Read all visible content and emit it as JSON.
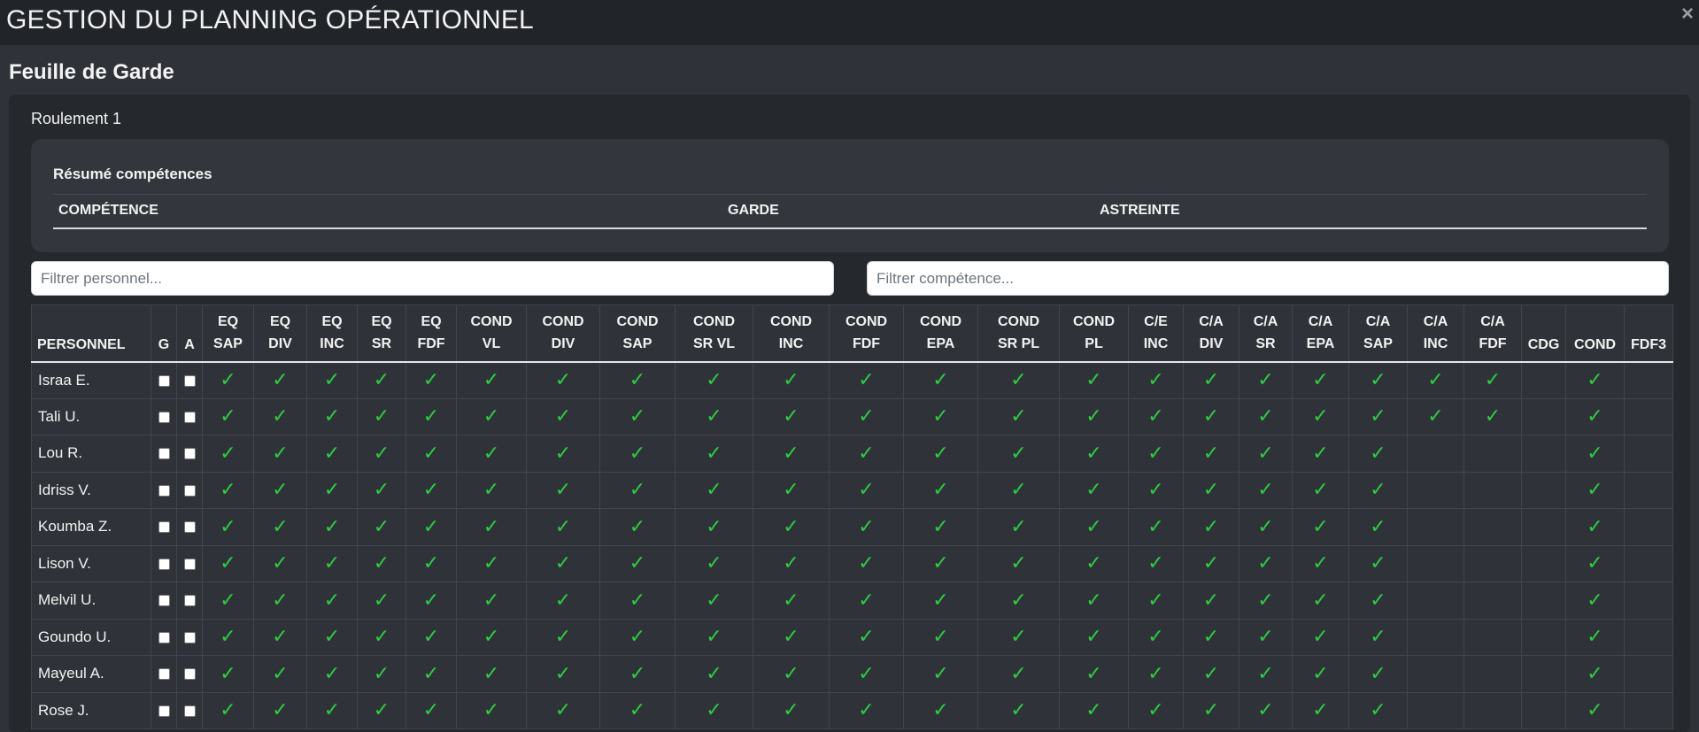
{
  "app": {
    "title": "GESTION DU PLANNING OPÉRATIONNEL",
    "close_label": "×"
  },
  "page": {
    "section_title": "Feuille de Garde",
    "roulement": "Roulement 1"
  },
  "summary": {
    "title": "Résumé compétences",
    "headers": [
      "COMPÉTENCE",
      "GARDE",
      "ASTREINTE"
    ]
  },
  "filters": {
    "personnel_placeholder": "Filtrer personnel...",
    "competence_placeholder": "Filtrer compétence..."
  },
  "colors": {
    "check": "#2ecc40",
    "background": "#2f3339",
    "header": "#212429"
  },
  "table": {
    "columns": [
      "PERSONNEL",
      "G",
      "A",
      "EQ SAP",
      "EQ DIV",
      "EQ INC",
      "EQ SR",
      "EQ FDF",
      "COND VL",
      "COND DIV",
      "COND SAP",
      "COND SR VL",
      "COND INC",
      "COND FDF",
      "COND EPA",
      "COND SR PL",
      "COND PL",
      "C/E INC",
      "C/A DIV",
      "C/A SR",
      "C/A EPA",
      "C/A SAP",
      "C/A INC",
      "C/A FDF",
      "CDG",
      "COND",
      "FDF3"
    ],
    "check_symbol": "✓",
    "rows": [
      {
        "name": "Israa E.",
        "checks": [
          1,
          1,
          1,
          1,
          1,
          1,
          1,
          1,
          1,
          1,
          1,
          1,
          1,
          1,
          1,
          1,
          1,
          1,
          1,
          1,
          1,
          0,
          1,
          0
        ]
      },
      {
        "name": "Tali U.",
        "checks": [
          1,
          1,
          1,
          1,
          1,
          1,
          1,
          1,
          1,
          1,
          1,
          1,
          1,
          1,
          1,
          1,
          1,
          1,
          1,
          1,
          1,
          0,
          1,
          0
        ]
      },
      {
        "name": "Lou R.",
        "checks": [
          1,
          1,
          1,
          1,
          1,
          1,
          1,
          1,
          1,
          1,
          1,
          1,
          1,
          1,
          1,
          1,
          1,
          1,
          1,
          0,
          0,
          0,
          1,
          0
        ]
      },
      {
        "name": "Idriss V.",
        "checks": [
          1,
          1,
          1,
          1,
          1,
          1,
          1,
          1,
          1,
          1,
          1,
          1,
          1,
          1,
          1,
          1,
          1,
          1,
          1,
          0,
          0,
          0,
          1,
          0
        ]
      },
      {
        "name": "Koumba Z.",
        "checks": [
          1,
          1,
          1,
          1,
          1,
          1,
          1,
          1,
          1,
          1,
          1,
          1,
          1,
          1,
          1,
          1,
          1,
          1,
          1,
          0,
          0,
          0,
          1,
          0
        ]
      },
      {
        "name": "Lison V.",
        "checks": [
          1,
          1,
          1,
          1,
          1,
          1,
          1,
          1,
          1,
          1,
          1,
          1,
          1,
          1,
          1,
          1,
          1,
          1,
          1,
          0,
          0,
          0,
          1,
          0
        ]
      },
      {
        "name": "Melvil U.",
        "checks": [
          1,
          1,
          1,
          1,
          1,
          1,
          1,
          1,
          1,
          1,
          1,
          1,
          1,
          1,
          1,
          1,
          1,
          1,
          1,
          0,
          0,
          0,
          1,
          0
        ]
      },
      {
        "name": "Goundo U.",
        "checks": [
          1,
          1,
          1,
          1,
          1,
          1,
          1,
          1,
          1,
          1,
          1,
          1,
          1,
          1,
          1,
          1,
          1,
          1,
          1,
          0,
          0,
          0,
          1,
          0
        ]
      },
      {
        "name": "Mayeul A.",
        "checks": [
          1,
          1,
          1,
          1,
          1,
          1,
          1,
          1,
          1,
          1,
          1,
          1,
          1,
          1,
          1,
          1,
          1,
          1,
          1,
          0,
          0,
          0,
          1,
          0
        ]
      },
      {
        "name": "Rose J.",
        "checks": [
          1,
          1,
          1,
          1,
          1,
          1,
          1,
          1,
          1,
          1,
          1,
          1,
          1,
          1,
          1,
          1,
          1,
          1,
          1,
          0,
          0,
          0,
          1,
          0
        ]
      }
    ]
  }
}
